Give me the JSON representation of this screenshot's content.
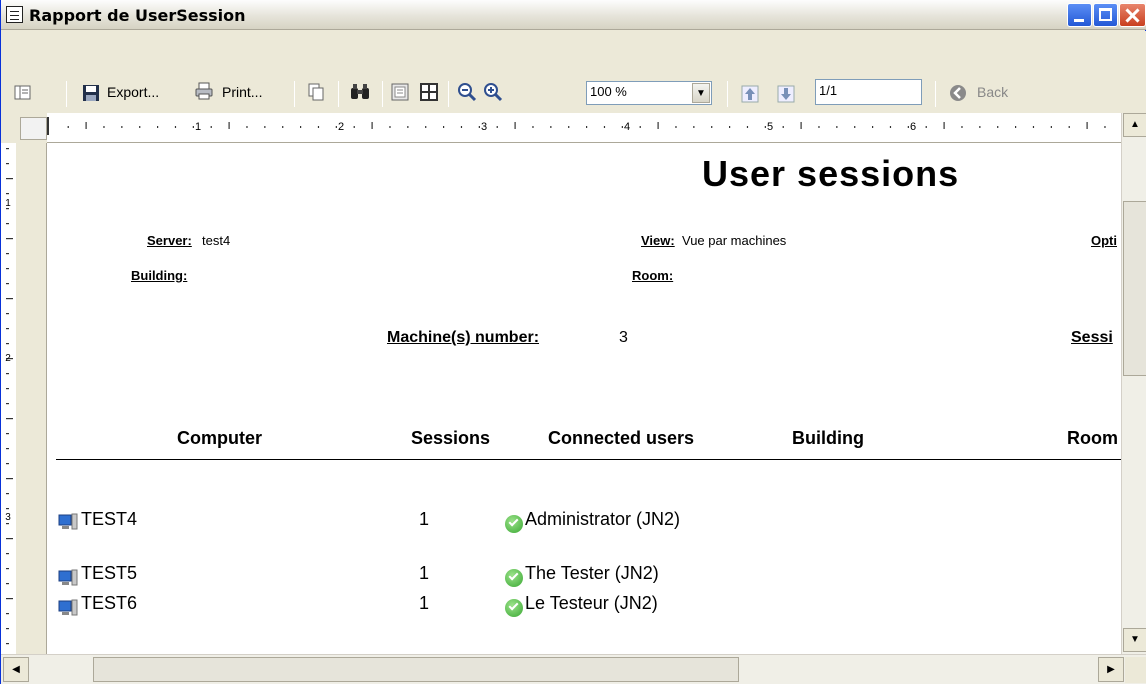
{
  "window": {
    "title": "Rapport de UserSession"
  },
  "toolbar": {
    "export_label": "Export...",
    "print_label": "Print...",
    "zoom_value": "100 %",
    "page_value": "1/1",
    "back_label": "Back"
  },
  "ruler": {
    "h_marks": [
      "1",
      "2",
      "3",
      "4",
      "5",
      "6"
    ],
    "v_marks": [
      "1",
      "2",
      "3"
    ]
  },
  "report": {
    "title": "User sessions",
    "server_label": "Server:",
    "server_value": "test4",
    "view_label": "View:",
    "view_value": "Vue par machines",
    "options_label_partial": "Opti",
    "building_label": "Building:",
    "room_label": "Room:",
    "machines_label": "Machine(s) number:",
    "machines_value": "3",
    "sessions_label_partial": "Sessi",
    "columns": [
      "Computer",
      "Sessions",
      "Connected users",
      "Building",
      "Room"
    ],
    "rows": [
      {
        "computer": "TEST4",
        "sessions": "1",
        "user": "Administrator (JN2)"
      },
      {
        "computer": "TEST5",
        "sessions": "1",
        "user": "The Tester (JN2)"
      },
      {
        "computer": "TEST6",
        "sessions": "1",
        "user": "Le Testeur (JN2)"
      }
    ]
  }
}
